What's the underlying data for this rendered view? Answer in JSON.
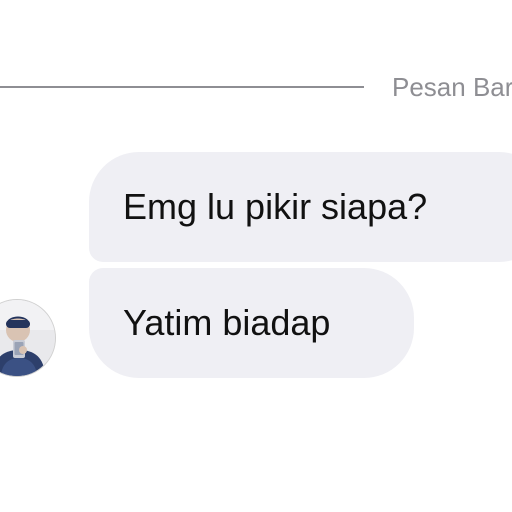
{
  "divider": {
    "label": "Pesan Baru"
  },
  "messages": [
    {
      "text": "Emg lu pikir siapa?"
    },
    {
      "text": "Yatim biadap"
    }
  ],
  "colors": {
    "bubble_background": "#efeff4",
    "divider": "#8e8e93",
    "text": "#111111"
  },
  "icons": {
    "avatar": "person-photo"
  }
}
